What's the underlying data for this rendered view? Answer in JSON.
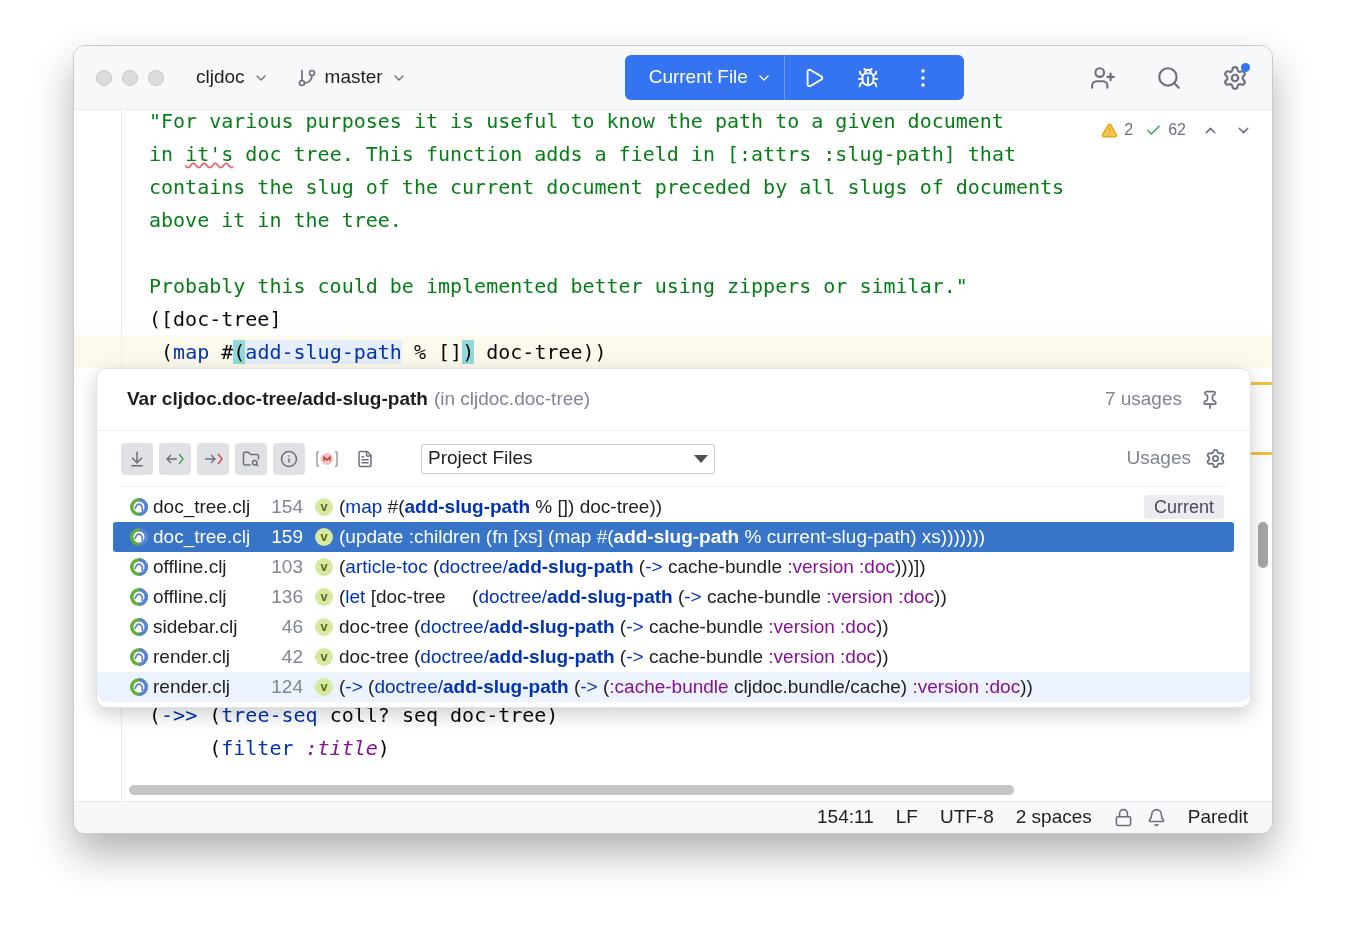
{
  "toolbar": {
    "project": "cljdoc",
    "branch": "master",
    "run_config": "Current File",
    "settings_badge": true
  },
  "editor": {
    "warnings": "2",
    "checks": "62",
    "docstring": [
      {
        "lines": [
          {
            "tokens": [
              {
                "kind": "str",
                "text": "\"For various purposes it is useful to know the path to a given document"
              }
            ]
          },
          {
            "tokens": [
              {
                "kind": "str",
                "text": "in "
              },
              {
                "kind": "typo",
                "text": "it's"
              },
              {
                "kind": "str",
                "text": " doc tree. This function adds a field in [:attrs :slug-path] that"
              }
            ]
          },
          {
            "tokens": [
              {
                "kind": "str",
                "text": "contains the slug of the current document preceded by all slugs of documents"
              }
            ]
          },
          {
            "tokens": [
              {
                "kind": "str",
                "text": "above it in the tree."
              }
            ]
          }
        ]
      },
      {
        "lines": [
          {
            "tokens": [
              {
                "kind": "str",
                "text": "Probably this could be implemented better using zippers or similar.\""
              }
            ]
          }
        ]
      }
    ],
    "lines_top": [
      {
        "current": false,
        "tokens": [
          {
            "kind": "plain",
            "text": "([doc-tree]"
          }
        ]
      },
      {
        "current": true,
        "tokens": [
          {
            "kind": "plain",
            "text": " ("
          },
          {
            "kind": "fn",
            "text": "map"
          },
          {
            "kind": "plain",
            "text": " #"
          },
          {
            "kind": "brace",
            "text": "("
          },
          {
            "kind": "ref",
            "text": "add-slug-path"
          },
          {
            "kind": "plain",
            "text": " % []"
          },
          {
            "kind": "brace",
            "text": ")"
          },
          {
            "kind": "plain",
            "text": " doc-tree))"
          }
        ]
      }
    ],
    "lines_bottom": [
      {
        "current": false,
        "tokens": [
          {
            "kind": "plain",
            "text": "("
          },
          {
            "kind": "fn",
            "text": "->>"
          },
          {
            "kind": "plain",
            "text": " ("
          },
          {
            "kind": "fn",
            "text": "tree-seq"
          },
          {
            "kind": "plain",
            "text": " coll? seq doc-tree)"
          }
        ]
      },
      {
        "current": false,
        "tokens": [
          {
            "kind": "plain",
            "text": "     ("
          },
          {
            "kind": "fn",
            "text": "filter"
          },
          {
            "kind": "kw",
            "text": " :title"
          },
          {
            "kind": "plain",
            "text": ")"
          }
        ]
      }
    ]
  },
  "popup": {
    "title": "Var cljdoc.doc-tree/add-slug-path",
    "context": "(in cljdoc.doc-tree)",
    "count": "7 usages",
    "scope": "Project Files",
    "usages_label": "Usages",
    "tools": [
      {
        "kind": "merge",
        "on": true
      },
      {
        "kind": "prev",
        "on": true
      },
      {
        "kind": "next",
        "on": true
      },
      {
        "kind": "folder",
        "on": true
      },
      {
        "kind": "info",
        "on": true
      },
      {
        "kind": "module",
        "on": false
      },
      {
        "kind": "preview",
        "on": false
      }
    ],
    "rows": [
      {
        "file": "doc_tree.clj",
        "line": "154",
        "var": "v",
        "selected": false,
        "hovered": false,
        "badge": "Current",
        "tokens": [
          {
            "kind": "plain",
            "text": "("
          },
          {
            "kind": "fn",
            "text": "map"
          },
          {
            "kind": "plain",
            "text": " #("
          },
          {
            "kind": "match",
            "text": "add-slug-path"
          },
          {
            "kind": "plain",
            "text": " % []) doc-tree))"
          }
        ]
      },
      {
        "file": "doc_tree.clj",
        "line": "159",
        "var": "v",
        "selected": true,
        "hovered": false,
        "tokens": [
          {
            "kind": "plain",
            "text": "(update :children (fn [xs] (map #("
          },
          {
            "kind": "match",
            "text": "add-slug-path"
          },
          {
            "kind": "plain",
            "text": " % current-slug-path) xs)))))))"
          }
        ]
      },
      {
        "file": "offline.clj",
        "line": "103",
        "var": "v",
        "selected": false,
        "hovered": false,
        "tokens": [
          {
            "kind": "plain",
            "text": "("
          },
          {
            "kind": "fn",
            "text": "article-toc"
          },
          {
            "kind": "plain",
            "text": " ("
          },
          {
            "kind": "fn",
            "text": "doctree/"
          },
          {
            "kind": "match",
            "text": "add-slug-path"
          },
          {
            "kind": "plain",
            "text": " ("
          },
          {
            "kind": "fn",
            "text": "->"
          },
          {
            "kind": "plain",
            "text": " cache-bundle "
          },
          {
            "kind": "kw",
            "text": ":version :doc"
          },
          {
            "kind": "plain",
            "text": ")))])"
          }
        ]
      },
      {
        "file": "offline.clj",
        "line": "136",
        "var": "v",
        "selected": false,
        "hovered": false,
        "tokens": [
          {
            "kind": "plain",
            "text": "("
          },
          {
            "kind": "fn",
            "text": "let"
          },
          {
            "kind": "plain",
            "text": " [doc-tree     ("
          },
          {
            "kind": "fn",
            "text": "doctree/"
          },
          {
            "kind": "match",
            "text": "add-slug-path"
          },
          {
            "kind": "plain",
            "text": " ("
          },
          {
            "kind": "fn",
            "text": "->"
          },
          {
            "kind": "plain",
            "text": " cache-bundle "
          },
          {
            "kind": "kw",
            "text": ":version :doc"
          },
          {
            "kind": "plain",
            "text": "))"
          }
        ]
      },
      {
        "file": "sidebar.clj",
        "line": "46",
        "var": "v",
        "selected": false,
        "hovered": false,
        "tokens": [
          {
            "kind": "plain",
            "text": "doc-tree ("
          },
          {
            "kind": "fn",
            "text": "doctree/"
          },
          {
            "kind": "match",
            "text": "add-slug-path"
          },
          {
            "kind": "plain",
            "text": " ("
          },
          {
            "kind": "fn",
            "text": "->"
          },
          {
            "kind": "plain",
            "text": " cache-bundle "
          },
          {
            "kind": "kw",
            "text": ":version :doc"
          },
          {
            "kind": "plain",
            "text": "))"
          }
        ]
      },
      {
        "file": "render.clj",
        "line": "42",
        "var": "v",
        "selected": false,
        "hovered": false,
        "tokens": [
          {
            "kind": "plain",
            "text": "doc-tree ("
          },
          {
            "kind": "fn",
            "text": "doctree/"
          },
          {
            "kind": "match",
            "text": "add-slug-path"
          },
          {
            "kind": "plain",
            "text": " ("
          },
          {
            "kind": "fn",
            "text": "->"
          },
          {
            "kind": "plain",
            "text": " cache-bundle "
          },
          {
            "kind": "kw",
            "text": ":version :doc"
          },
          {
            "kind": "plain",
            "text": "))"
          }
        ]
      },
      {
        "file": "render.clj",
        "line": "124",
        "var": "v",
        "selected": false,
        "hovered": true,
        "tokens": [
          {
            "kind": "plain",
            "text": "("
          },
          {
            "kind": "fn",
            "text": "->"
          },
          {
            "kind": "plain",
            "text": " ("
          },
          {
            "kind": "fn",
            "text": "doctree/"
          },
          {
            "kind": "match",
            "text": "add-slug-path"
          },
          {
            "kind": "plain",
            "text": " ("
          },
          {
            "kind": "fn",
            "text": "->"
          },
          {
            "kind": "plain",
            "text": " ("
          },
          {
            "kind": "kw",
            "text": ":cache-bundle"
          },
          {
            "kind": "plain",
            "text": " cljdoc.bundle/cache) "
          },
          {
            "kind": "kw",
            "text": ":version :doc"
          },
          {
            "kind": "plain",
            "text": "))"
          }
        ]
      }
    ]
  },
  "status_bar": {
    "position": "154:11",
    "line_ending": "LF",
    "encoding": "UTF-8",
    "indent": "2 spaces",
    "mode": "Paredit"
  }
}
